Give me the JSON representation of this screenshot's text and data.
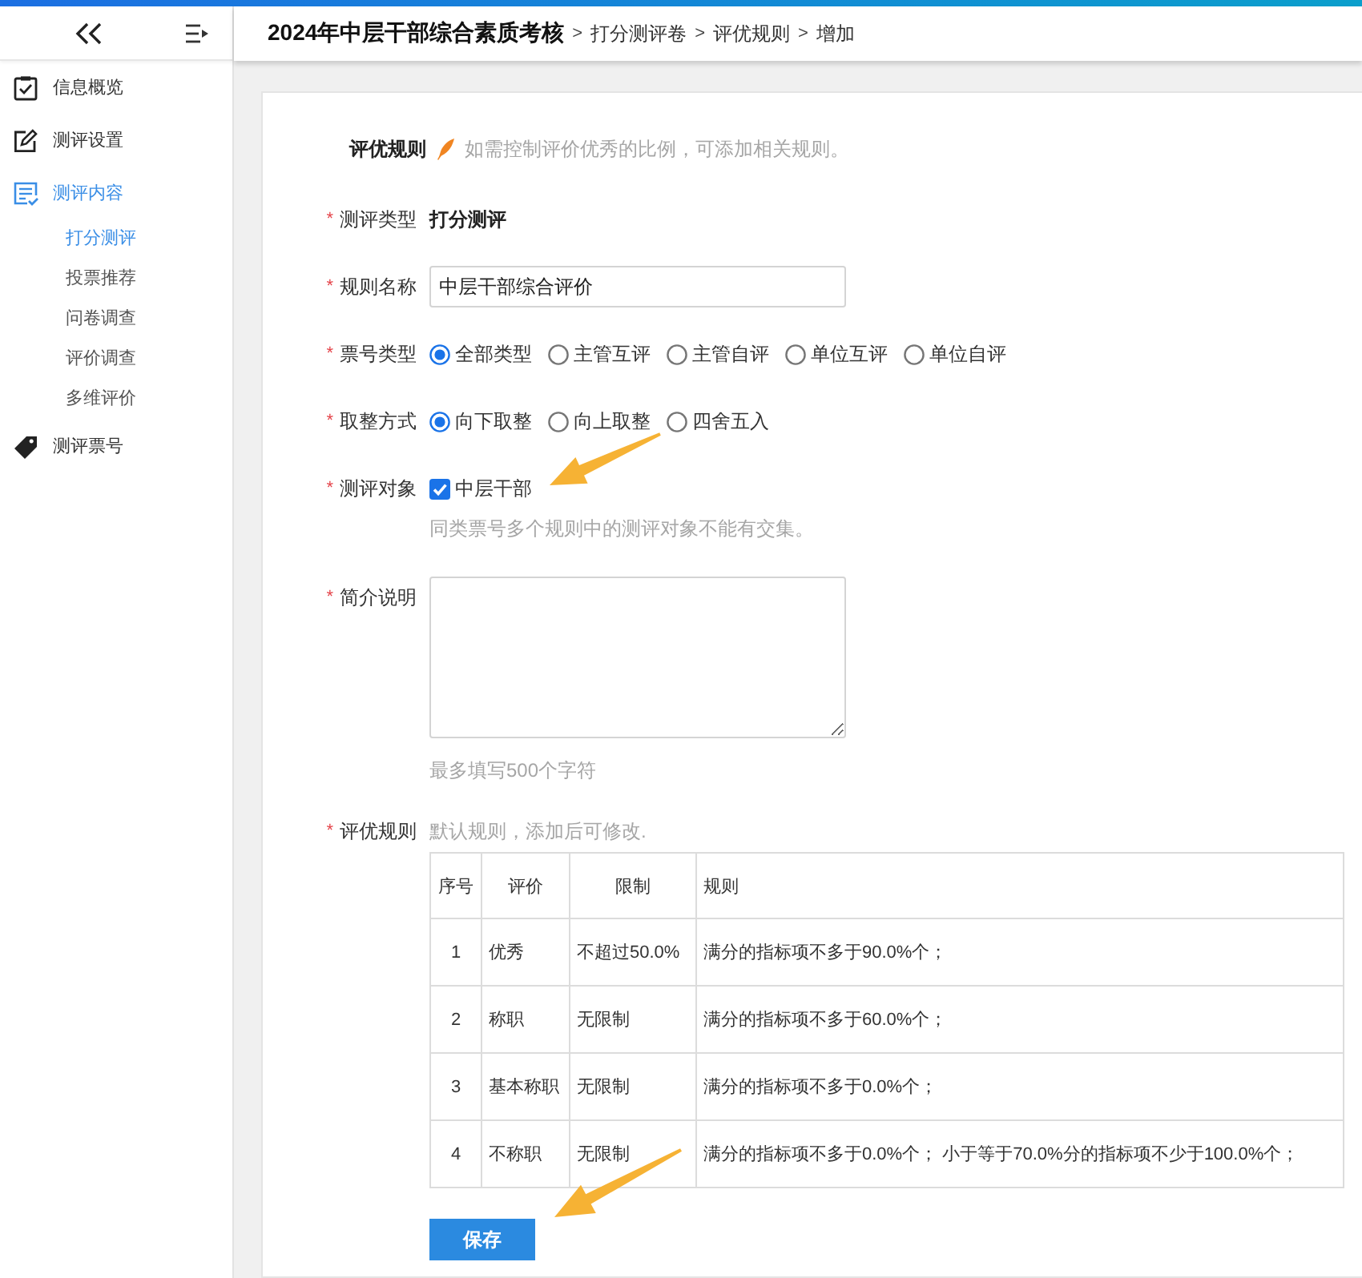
{
  "sidebar": {
    "items": [
      {
        "label": "信息概览",
        "selected": false
      },
      {
        "label": "测评设置",
        "selected": false
      },
      {
        "label": "测评内容",
        "selected": true,
        "children": [
          {
            "label": "打分测评",
            "selected": true
          },
          {
            "label": "投票推荐",
            "selected": false
          },
          {
            "label": "问卷调查",
            "selected": false
          },
          {
            "label": "评价调查",
            "selected": false
          },
          {
            "label": "多维评价",
            "selected": false
          }
        ]
      },
      {
        "label": "测评票号",
        "selected": false
      }
    ]
  },
  "header": {
    "title": "2024年中层干部综合素质考核",
    "breadcrumb": [
      {
        "separator": ">",
        "label": "打分测评卷"
      },
      {
        "separator": ">",
        "label": "评优规则"
      },
      {
        "separator": ">",
        "label": "增加"
      }
    ]
  },
  "form": {
    "section": {
      "title": "评优规则",
      "hint": "如需控制评价优秀的比例，可添加相关规则。"
    },
    "fields": [
      {
        "kind": "text",
        "mark": "*",
        "label": "测评类型",
        "value": "打分测评"
      },
      {
        "kind": "input",
        "mark": "*",
        "label": "规则名称",
        "value": "中层干部综合评价"
      },
      {
        "kind": "radio",
        "mark": "*",
        "label": "票号类型",
        "options": [
          {
            "label": "全部类型",
            "selected": true
          },
          {
            "label": "主管互评",
            "selected": false
          },
          {
            "label": "主管自评",
            "selected": false
          },
          {
            "label": "单位互评",
            "selected": false
          },
          {
            "label": "单位自评",
            "selected": false
          }
        ]
      },
      {
        "kind": "radio",
        "mark": "*",
        "label": "取整方式",
        "options": [
          {
            "label": "向下取整",
            "selected": true
          },
          {
            "label": "向上取整",
            "selected": false
          },
          {
            "label": "四舍五入",
            "selected": false
          }
        ]
      },
      {
        "kind": "checkbox",
        "mark": "*",
        "label": "测评对象",
        "options": [
          {
            "label": "中层干部",
            "checked": true
          }
        ],
        "hint": "同类票号多个规则中的测评对象不能有交集。"
      },
      {
        "kind": "textarea",
        "mark": "*",
        "label": "简介说明",
        "hint": "最多填写500个字符"
      },
      {
        "kind": "table",
        "mark": "*",
        "label": "评优规则",
        "note": "默认规则，添加后可修改.",
        "columns": [
          "序号",
          "评价",
          "限制",
          "规则"
        ],
        "rows": [
          [
            "1",
            "优秀",
            "不超过50.0%",
            "满分的指标项不多于90.0%个；"
          ],
          [
            "2",
            "称职",
            "无限制",
            "满分的指标项不多于60.0%个；"
          ],
          [
            "3",
            "基本称职",
            "无限制",
            "满分的指标项不多于0.0%个；"
          ],
          [
            "4",
            "不称职",
            "无限制",
            "满分的指标项不多于0.0%个； 小于等于70.0%分的指标项不少于100.0%个；"
          ]
        ]
      }
    ],
    "save_button": "保存"
  }
}
